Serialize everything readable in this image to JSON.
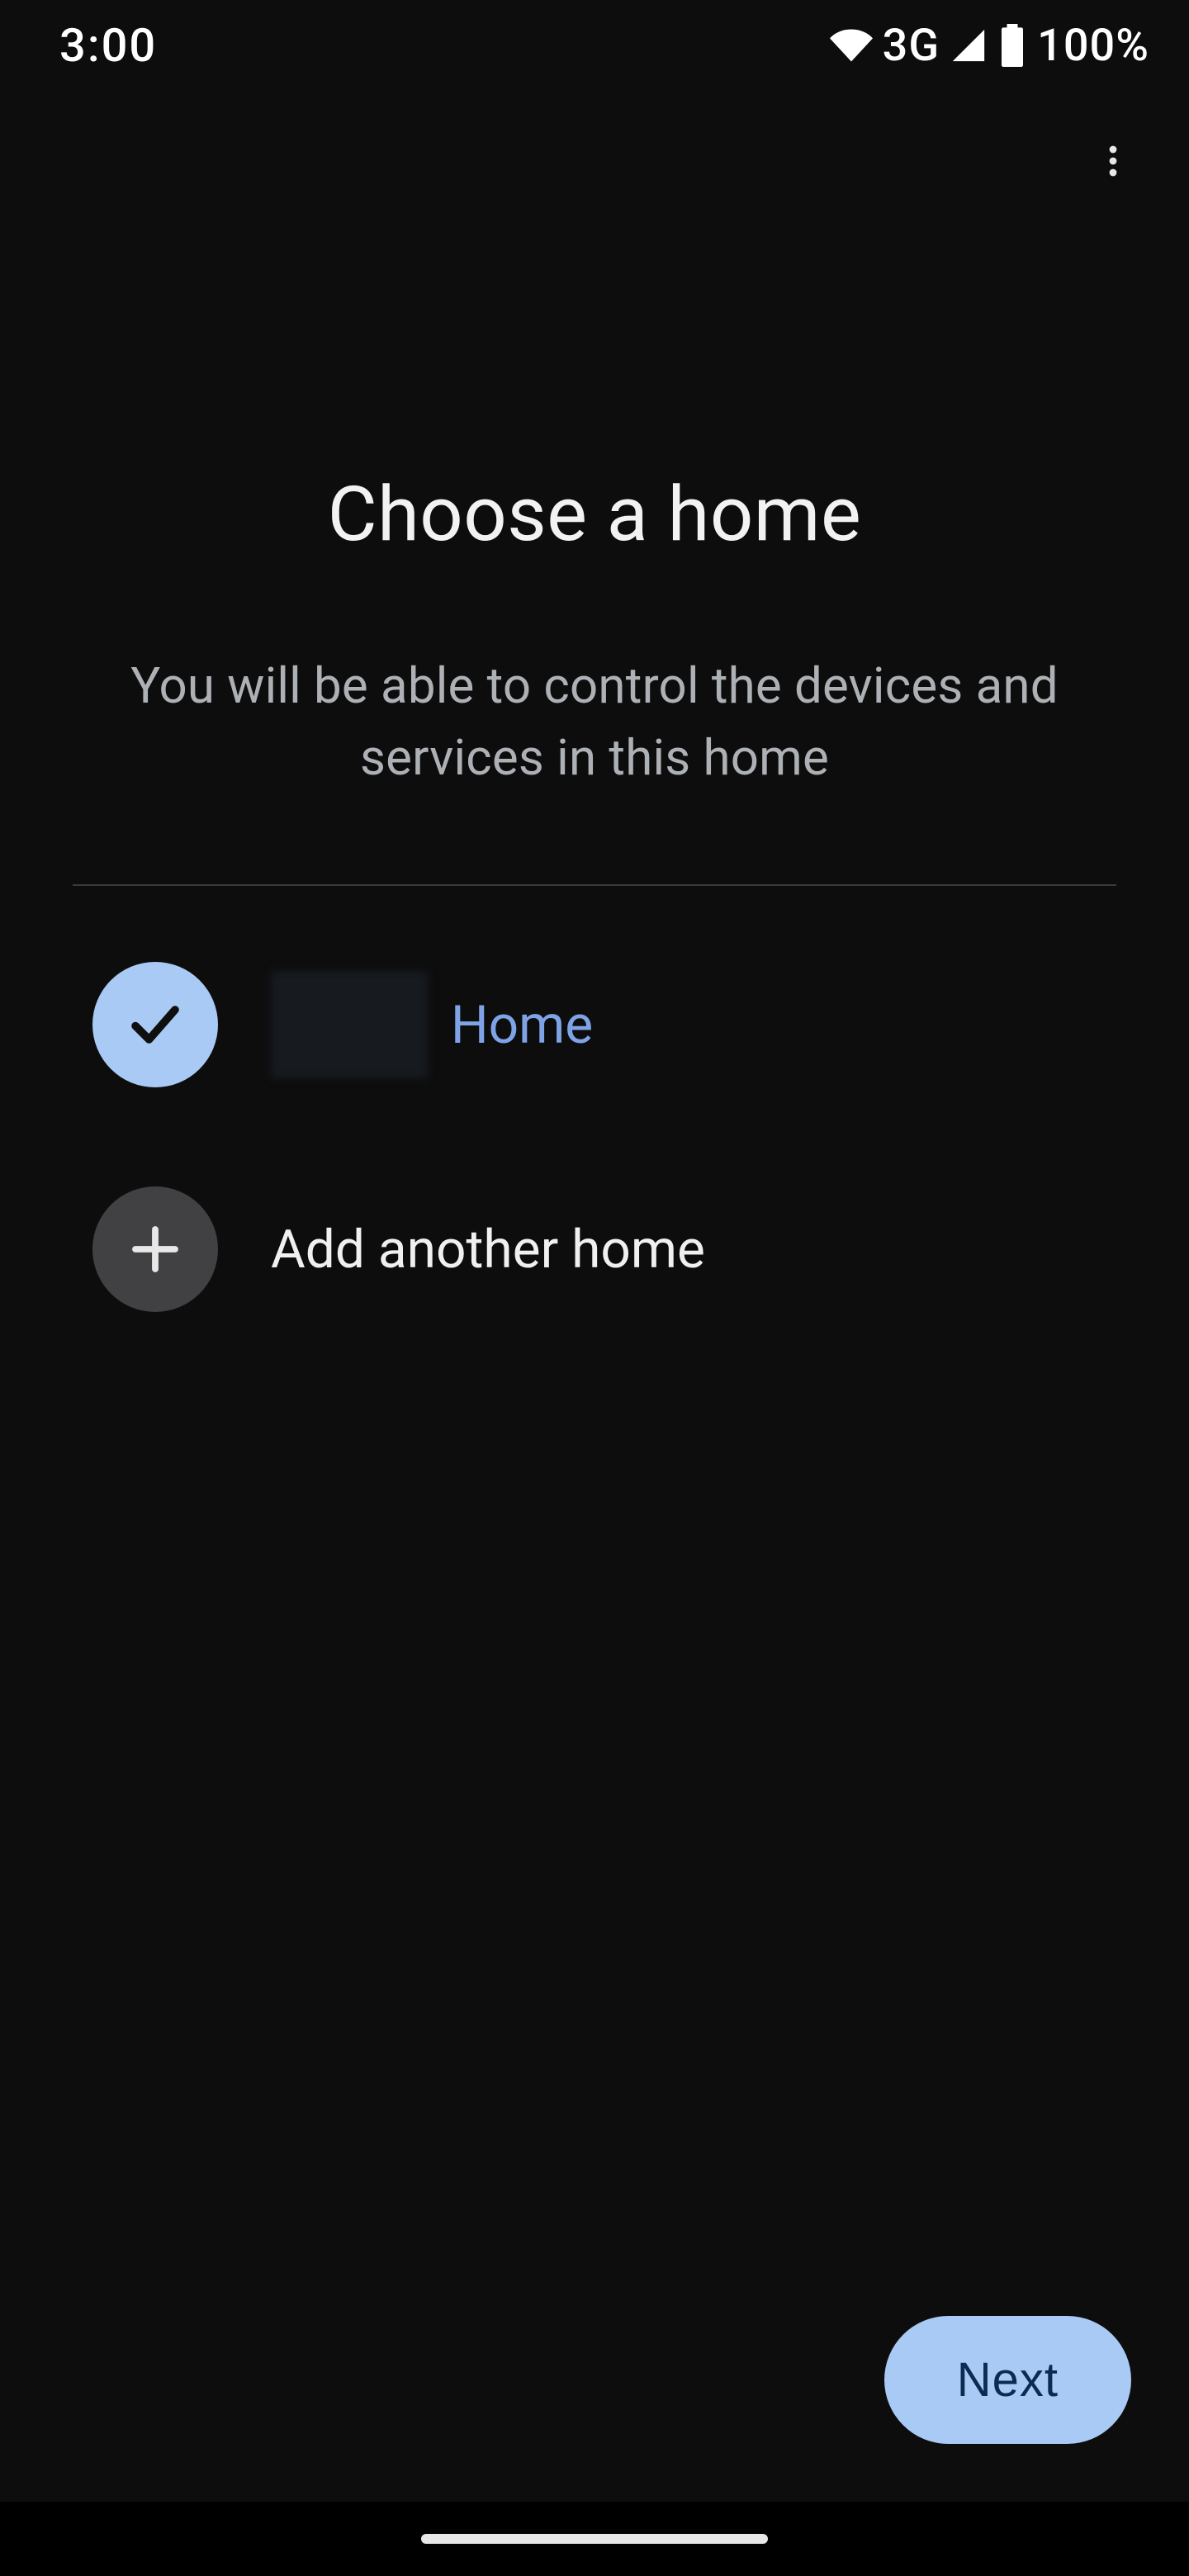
{
  "status_bar": {
    "time": "3:00",
    "network_type": "3G",
    "battery": "100%"
  },
  "page": {
    "title": "Choose a home",
    "subtitle": "You will be able to control the devices and services in this home"
  },
  "options": {
    "selected_home": {
      "label": "Home",
      "selected": true
    },
    "add_home": {
      "label": "Add another home"
    }
  },
  "buttons": {
    "next": "Next"
  },
  "icons": {
    "overflow": "more-vert",
    "wifi": "wifi",
    "signal": "cellular",
    "battery": "battery-full",
    "check": "check",
    "plus": "plus"
  },
  "colors": {
    "accent": "#a9caf5",
    "accent_text": "#0c2b52",
    "link": "#7ea3e6",
    "background": "#0d0d0d"
  }
}
